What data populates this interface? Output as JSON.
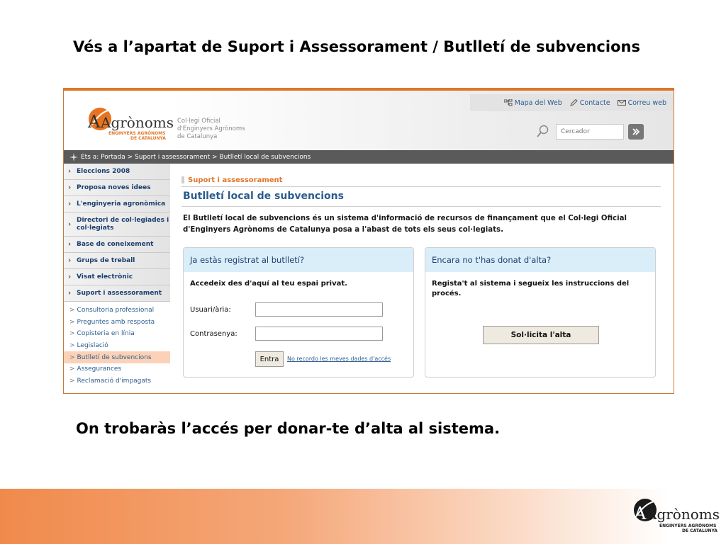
{
  "slide": {
    "title": "Vés a l’apartat de Suport i Assessorament / Butlletí de subvencions",
    "caption": "On trobaràs l’accés per donar-te d’alta al sistema."
  },
  "logo": {
    "word": "Agrònoms",
    "line1": "ENGINYERS AGRÒNOMS",
    "line2": "DE CATALUNYA"
  },
  "header": {
    "org_name": [
      "Col·legi Oficial",
      "d'Enginyers Agrònoms",
      "de Catalunya"
    ],
    "top_links": [
      {
        "label": "Mapa del Web",
        "icon": "sitemap-icon"
      },
      {
        "label": "Contacte",
        "icon": "pencil-icon"
      },
      {
        "label": "Correu web",
        "icon": "envelope-icon"
      }
    ],
    "search_placeholder": "Cercador"
  },
  "breadcrumb": "Ets a: Portada > Suport i assessorament > Butlletí local de subvencions",
  "sidebar": {
    "items": [
      {
        "label": "Eleccions 2008"
      },
      {
        "label": "Proposa noves idees"
      },
      {
        "label": "L'enginyeria agronòmica"
      },
      {
        "label": "Directori de col·legiades i col·legiats"
      },
      {
        "label": "Base de coneixement"
      },
      {
        "label": "Grups de treball"
      },
      {
        "label": "Visat electrònic"
      },
      {
        "label": "Suport i assessorament"
      }
    ],
    "sub_items": [
      {
        "label": "Consultoria professional"
      },
      {
        "label": "Preguntes amb resposta"
      },
      {
        "label": "Copisteria en línia"
      },
      {
        "label": "Legislació"
      },
      {
        "label": "Butlletí de subvencions"
      },
      {
        "label": "Assegurances"
      },
      {
        "label": "Reclamació d'impagats"
      }
    ]
  },
  "main": {
    "section": "Suport i assessorament",
    "title": "Butlletí local de subvencions",
    "intro": "El Butlletí local de subvencions és un sistema d'informació de recursos de finançament que el Col·legi Oficial d'Enginyers Agrònoms de Catalunya posa a l'abast de tots els seus col·legiats.",
    "login_panel": {
      "title": "Ja estàs registrat al butlletí?",
      "lead": "Accedeix des d'aquí al teu espai privat.",
      "user_label": "Usuari/ària:",
      "password_label": "Contrasenya:",
      "enter_label": "Entra",
      "forgot_label": "No recordo les meves dades d'accés"
    },
    "signup_panel": {
      "title": "Encara no t'has donat d'alta?",
      "lead": "Regista't al sistema i segueix les instruccions del procés.",
      "button_label": "Sol·licita l'alta"
    }
  },
  "colors": {
    "accent_orange": "#e0762a",
    "link_blue": "#2b5d8f",
    "panel_head": "#daeefa"
  }
}
